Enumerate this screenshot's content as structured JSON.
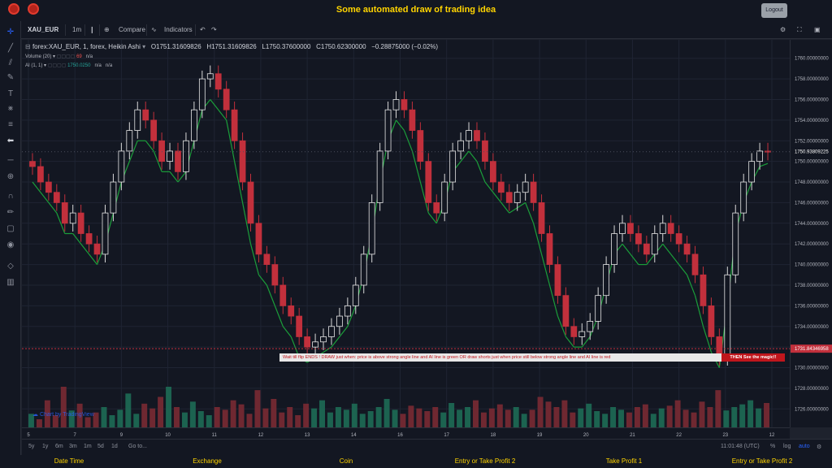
{
  "header": {
    "title": "Some automated draw of trading idea",
    "logout_label": "Logout"
  },
  "toolbar": {
    "symbol": "XAU_EUR",
    "interval": "1m",
    "compare_label": "Compare",
    "indicators_label": "Indicators"
  },
  "legend": {
    "series": "forex:XAU_EUR, 1, forex, Heikin Ashi",
    "open": "O1751.31609826",
    "high": "H1751.31609826",
    "low": "L1750.37600000",
    "close": "C1750.62300000",
    "change": "−0.28875000 (−0.02%)",
    "volume_label": "Volume (20)",
    "volume_value": "69",
    "volume_na": "n/a",
    "ai_label": "AI (1, 1)",
    "ai_value": "1750.0250",
    "ai_na1": "n/a",
    "ai_na2": "n/a"
  },
  "watermark": "Chart by TradingView",
  "banner": {
    "text": "Wait till flip ENDS   !    DRAW just when:  price is above strong angle line and AI line is green          OR          draw shorts just when price still below strong angle line and AI line is red",
    "end_text": "THEN See the magic!!"
  },
  "price_axis": {
    "ticks": [
      "1760.00000000",
      "1758.00000000",
      "1756.00000000",
      "1754.00000000",
      "1752.00000000",
      "1750.00000000",
      "1748.00000000",
      "1746.00000000",
      "1744.00000000",
      "1742.00000000",
      "1740.00000000",
      "1738.00000000",
      "1736.00000000",
      "1734.00000000",
      "1732.00000000",
      "1730.00000000",
      "1728.00000000",
      "1726.00000000"
    ],
    "current_label": "1750.93809225",
    "marker_label": "1731.84346958"
  },
  "time_axis": {
    "ticks": [
      "5",
      "7",
      "9",
      "10",
      "11",
      "12",
      "13",
      "14",
      "16",
      "17",
      "18",
      "19",
      "20",
      "21",
      "22",
      "23",
      "12"
    ]
  },
  "bottom_tools": {
    "ranges": [
      "5y",
      "1y",
      "6m",
      "3m",
      "1m",
      "5d",
      "1d"
    ],
    "goto_label": "Go to...",
    "clock": "11:01:48 (UTC)",
    "percent": "%",
    "log": "log",
    "auto": "auto"
  },
  "footer": {
    "columns": [
      "Date Time",
      "Exchange",
      "Coin",
      "Entry or Take Profit 2",
      "Take Profit 1",
      "Entry or Take Profit 2"
    ]
  },
  "chart_data": {
    "type": "candlestick",
    "price_range": [
      1725,
      1761
    ],
    "closes": [
      1749.5,
      1748,
      1747,
      1746,
      1744,
      1745,
      1743,
      1742,
      1741,
      1745,
      1748,
      1751,
      1753,
      1755,
      1754,
      1752,
      1750,
      1751,
      1749,
      1752,
      1755,
      1758,
      1758.5,
      1757,
      1755,
      1752,
      1748,
      1744,
      1741,
      1740,
      1738,
      1736,
      1735,
      1733,
      1732,
      1732.5,
      1733,
      1734,
      1735,
      1736,
      1738,
      1741,
      1746,
      1751,
      1755,
      1756,
      1755,
      1753,
      1750,
      1746,
      1745,
      1748,
      1751,
      1752,
      1753,
      1752,
      1750,
      1748,
      1747,
      1746,
      1747,
      1748,
      1746,
      1743,
      1740,
      1737,
      1734,
      1733,
      1733.5,
      1734.5,
      1737,
      1740,
      1743,
      1744,
      1743,
      1742,
      1741,
      1743,
      1744,
      1743,
      1742,
      1741,
      1739,
      1736,
      1733,
      1731,
      1739,
      1745,
      1748,
      1750,
      1751,
      1750.9
    ],
    "ai_line": [
      1748,
      1747,
      1746,
      1745,
      1743,
      1743,
      1742,
      1741,
      1740,
      1742,
      1745,
      1748,
      1750,
      1752,
      1752,
      1751,
      1749,
      1749,
      1748,
      1749,
      1752,
      1755,
      1756,
      1755,
      1754,
      1750,
      1746,
      1742,
      1739,
      1738,
      1736,
      1734,
      1733,
      1731,
      1730.5,
      1731,
      1731.5,
      1732,
      1733,
      1734,
      1736,
      1739,
      1743,
      1748,
      1752,
      1754,
      1753,
      1751,
      1748,
      1745,
      1744,
      1746,
      1749,
      1750,
      1751,
      1750,
      1748,
      1747,
      1746,
      1745,
      1745.5,
      1746,
      1744,
      1741,
      1738,
      1735,
      1733,
      1732,
      1732,
      1733,
      1735,
      1738,
      1741,
      1742,
      1741,
      1740,
      1740,
      1741,
      1742,
      1741,
      1740,
      1739,
      1737,
      1734,
      1731.5,
      1730,
      1736,
      1743,
      1746,
      1748,
      1749.5,
      1749.8
    ],
    "volume": [
      20,
      12,
      40,
      18,
      60,
      25,
      35,
      15,
      22,
      30,
      18,
      26,
      50,
      20,
      35,
      28,
      45,
      60,
      30,
      22,
      38,
      24,
      18,
      30,
      26,
      40,
      34,
      20,
      55,
      28,
      42,
      22,
      30,
      18,
      35,
      28,
      40,
      22,
      30,
      26,
      35,
      20,
      24,
      30,
      42,
      26,
      20,
      32,
      28,
      24,
      30,
      22,
      36,
      26,
      30,
      40,
      22,
      28,
      34,
      26,
      30,
      20,
      26,
      45,
      38,
      30,
      40,
      22,
      28,
      35,
      24,
      20,
      30,
      26,
      22,
      30,
      34,
      20,
      28,
      32,
      40,
      26,
      22,
      38,
      30,
      55,
      25,
      30,
      34,
      40,
      28,
      36
    ]
  }
}
